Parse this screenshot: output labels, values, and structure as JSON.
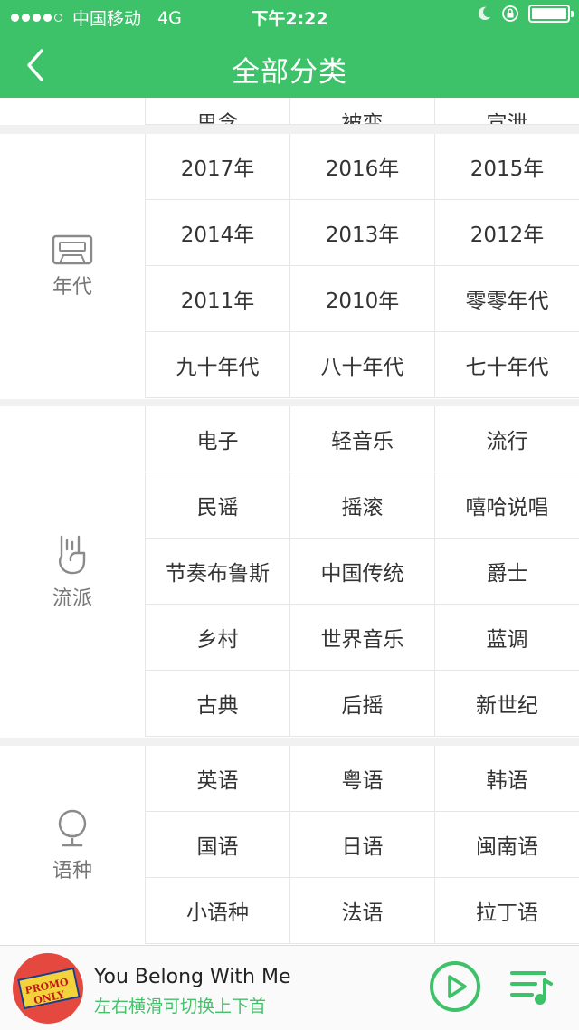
{
  "status_bar": {
    "carrier": "中国移动",
    "network": "4G",
    "time": "下午2:22"
  },
  "header": {
    "title": "全部分类",
    "back_icon": "chevron-left-icon"
  },
  "top_partial_row": [
    "思念",
    "被变",
    "宣泄"
  ],
  "sections": [
    {
      "label": "年代",
      "icon": "cassette-icon",
      "items": [
        [
          "2017年",
          "2016年",
          "2015年"
        ],
        [
          "2014年",
          "2013年",
          "2012年"
        ],
        [
          "2011年",
          "2010年",
          "零零年代"
        ],
        [
          "九十年代",
          "八十年代",
          "七十年代"
        ]
      ]
    },
    {
      "label": "流派",
      "icon": "rock-hand-icon",
      "items": [
        [
          "电子",
          "轻音乐",
          "流行"
        ],
        [
          "民谣",
          "摇滚",
          "嘻哈说唱"
        ],
        [
          "节奏布鲁斯",
          "中国传统",
          "爵士"
        ],
        [
          "乡村",
          "世界音乐",
          "蓝调"
        ],
        [
          "古典",
          "后摇",
          "新世纪"
        ]
      ]
    },
    {
      "label": "语种",
      "icon": "globe-icon",
      "items": [
        [
          "英语",
          "粤语",
          "韩语"
        ],
        [
          "国语",
          "日语",
          "闽南语"
        ],
        [
          "小语种",
          "法语",
          "拉丁语"
        ]
      ]
    }
  ],
  "player": {
    "song_title": "You Belong With Me",
    "hint": "左右横滑可切换上下首",
    "album_text": "PROMO ONLY",
    "accent_color": "#3dc169"
  }
}
